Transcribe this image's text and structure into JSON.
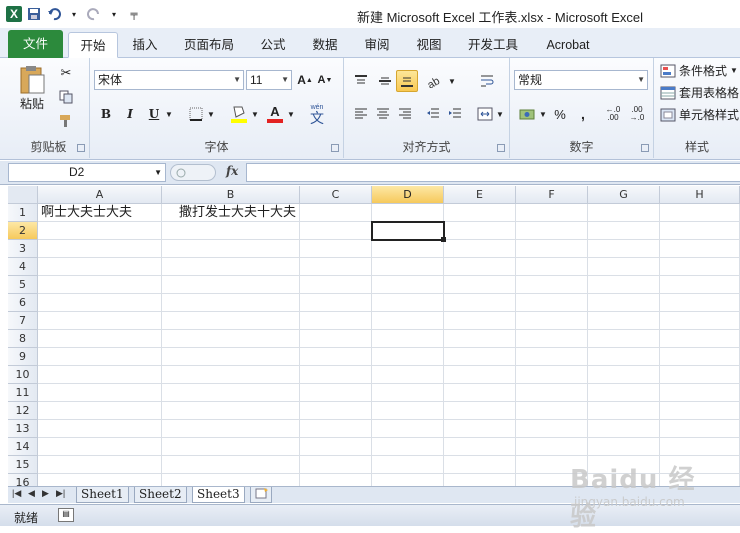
{
  "window": {
    "title": "新建 Microsoft Excel 工作表.xlsx  -  Microsoft Excel"
  },
  "qat": [
    "excel-app-icon",
    "save-icon",
    "undo-icon",
    "redo-icon",
    "customize-icon"
  ],
  "tabs": [
    {
      "label": "文件"
    },
    {
      "label": "开始"
    },
    {
      "label": "插入"
    },
    {
      "label": "页面布局"
    },
    {
      "label": "公式"
    },
    {
      "label": "数据"
    },
    {
      "label": "审阅"
    },
    {
      "label": "视图"
    },
    {
      "label": "开发工具"
    },
    {
      "label": "Acrobat"
    }
  ],
  "ribbon": {
    "clipboard": {
      "label": "剪贴板",
      "paste": "粘贴"
    },
    "font": {
      "label": "字体",
      "name": "宋体",
      "size": "11",
      "bold": "B",
      "italic": "I",
      "underline": "U"
    },
    "alignment": {
      "label": "对齐方式"
    },
    "number": {
      "label": "数字",
      "format": "常规",
      "percent": "%",
      "comma": ","
    },
    "styles": {
      "label": "样式",
      "conditional": "条件格式",
      "table": "套用表格格",
      "cell": "单元格样式"
    }
  },
  "formula_bar": {
    "name_box": "D2",
    "fx": "fx",
    "value": ""
  },
  "grid": {
    "columns": [
      "A",
      "B",
      "C",
      "D",
      "E",
      "F",
      "G",
      "H"
    ],
    "selected_column": "D",
    "rows": [
      "1",
      "2",
      "3",
      "4",
      "5",
      "6",
      "7",
      "8",
      "9",
      "10",
      "11",
      "12",
      "13",
      "14",
      "15",
      "16"
    ],
    "selected_row": "2",
    "cells": {
      "A1": "啊士大夫士大夫",
      "B1": "撒打发士大夫十大夫"
    }
  },
  "sheets": [
    {
      "label": "Sheet1"
    },
    {
      "label": "Sheet2"
    },
    {
      "label": "Sheet3"
    }
  ],
  "active_sheet": "Sheet3",
  "status": {
    "text": "就绪"
  },
  "watermark": {
    "main": "Baidu 经验",
    "sub": "jingyan.baidu.com"
  }
}
